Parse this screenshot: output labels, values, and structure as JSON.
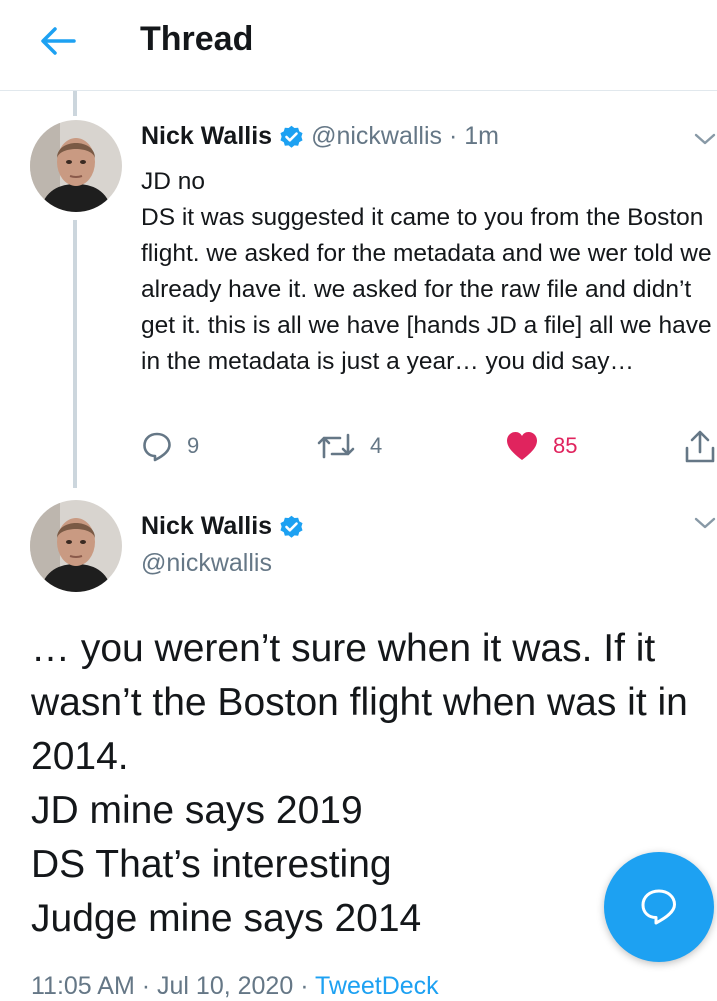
{
  "header": {
    "title": "Thread"
  },
  "tweet1": {
    "name": "Nick Wallis",
    "handle": "@nickwallis",
    "separator": "·",
    "time": "1m",
    "text": "JD no\nDS it was suggested it came to you from the Boston flight. we asked for the metadata and we wer told we already have it. we asked for the raw file and didn’t get it. this is all we have [hands JD a file] all we have in the metadata is just a year… you did say…",
    "replies": "9",
    "retweets": "4",
    "likes": "85"
  },
  "tweet2": {
    "name": "Nick Wallis",
    "handle": "@nickwallis",
    "text": "… you weren’t sure when it was. If it wasn’t the Boston flight when was it in 2014.\nJD mine says 2019\nDS That’s interesting\nJudge mine says 2014",
    "time": "11:05 AM",
    "dot": "·",
    "date": "Jul 10, 2020",
    "source": "TweetDeck"
  },
  "colors": {
    "accent": "#1da1f2",
    "like": "#e0245e",
    "muted": "#657786",
    "verified": "#1da1f2"
  },
  "icons": [
    "back-arrow-icon",
    "verified-badge-icon",
    "chevron-down-icon",
    "reply-icon",
    "retweet-icon",
    "heart-icon",
    "share-icon",
    "compose-reply-icon"
  ]
}
